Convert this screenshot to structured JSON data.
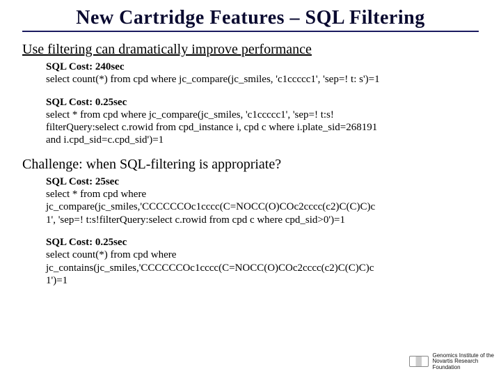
{
  "title": "New Cartridge Features – SQL Filtering",
  "section1": "Use filtering can dramatically improve performance",
  "block1": {
    "cost": "SQL Cost: 240sec",
    "line1": "select count(*) from cpd where  jc_compare(jc_smiles, 'c1ccccc1', 'sep=! t: s')=1"
  },
  "block2": {
    "cost": "SQL Cost: 0.25sec",
    "line1": "select * from cpd where jc_compare(jc_smiles, 'c1ccccc1', 'sep=! t:s!",
    "line2": "filterQuery:select c.rowid from cpd_instance i, cpd c where i.plate_sid=268191",
    "line3": "and i.cpd_sid=c.cpd_sid')=1"
  },
  "section2": "Challenge: when SQL-filtering is appropriate?",
  "block3": {
    "cost": "SQL Cost: 25sec",
    "line1": "select * from cpd where",
    "line2": "jc_compare(jc_smiles,'CCCCCCOc1cccc(C=NOCC(O)COc2cccc(c2)C(C)C)c",
    "line3": "1', 'sep=! t:s!filterQuery:select c.rowid from cpd c where cpd_sid>0')=1"
  },
  "block4": {
    "cost": "SQL Cost: 0.25sec",
    "line1": "select count(*) from cpd where",
    "line2": "jc_contains(jc_smiles,'CCCCCCOc1cccc(C=NOCC(O)COc2cccc(c2)C(C)C)c",
    "line3": "1')=1"
  },
  "footer": {
    "l1": "Genomics Institute of the",
    "l2": "Novartis Research",
    "l3": "Foundation"
  }
}
